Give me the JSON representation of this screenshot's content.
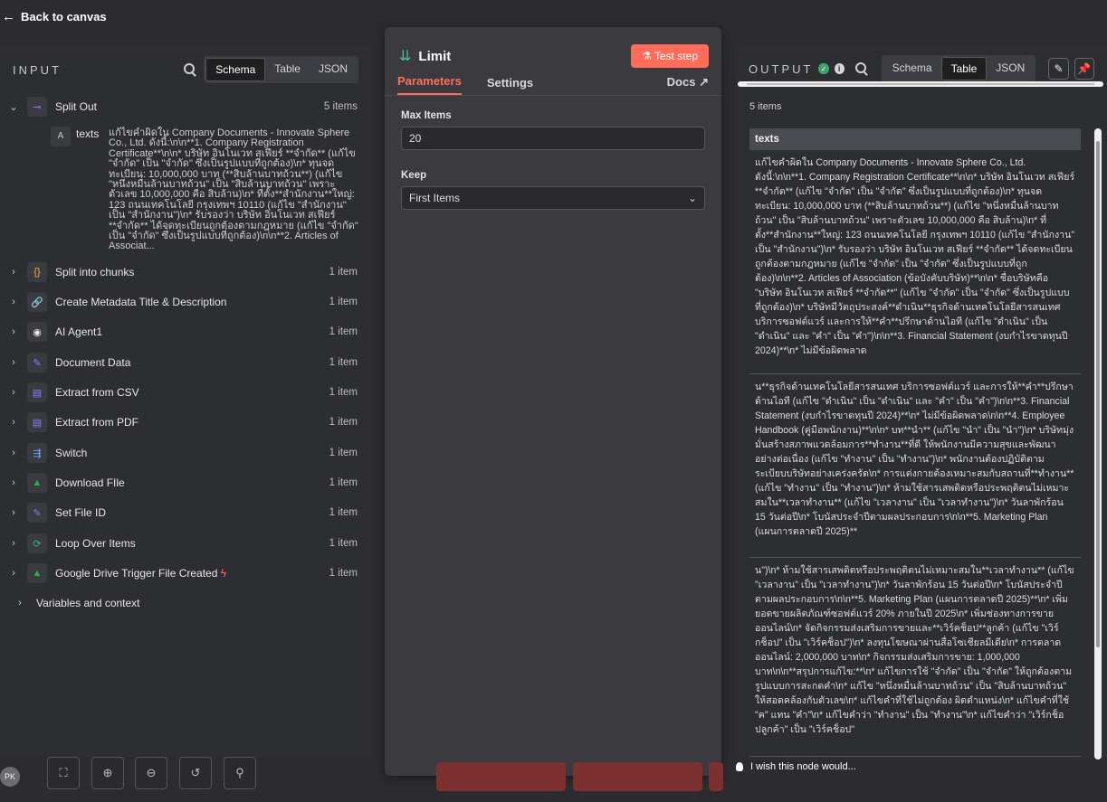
{
  "nav": {
    "back_label": "Back to canvas"
  },
  "input": {
    "title": "INPUT",
    "views": [
      "Schema",
      "Table",
      "JSON"
    ],
    "active_view": "Schema",
    "tree": [
      {
        "label": "Split Out",
        "count": "5 items",
        "icon": "split-out-icon",
        "expanded": true
      },
      {
        "label": "Split into chunks",
        "count": "1 item",
        "icon": "code-braces-icon"
      },
      {
        "label": "Create Metadata Title & Description",
        "count": "1 item",
        "icon": "link-icon"
      },
      {
        "label": "AI Agent1",
        "count": "1 item",
        "icon": "robot-icon"
      },
      {
        "label": "Document Data",
        "count": "1 item",
        "icon": "pencil-icon"
      },
      {
        "label": "Extract from CSV",
        "count": "1 item",
        "icon": "extract-icon"
      },
      {
        "label": "Extract from PDF",
        "count": "1 item",
        "icon": "extract-icon"
      },
      {
        "label": "Switch",
        "count": "1 item",
        "icon": "switch-icon"
      },
      {
        "label": "Download FIle",
        "count": "1 item",
        "icon": "google-drive-icon"
      },
      {
        "label": "Set File ID",
        "count": "1 item",
        "icon": "pencil-icon"
      },
      {
        "label": "Loop Over Items",
        "count": "1 item",
        "icon": "loop-icon"
      },
      {
        "label": "Google Drive Trigger File Created",
        "count": "1 item",
        "icon": "google-drive-icon"
      }
    ],
    "variables_label": "Variables and context",
    "texts_key": "texts",
    "texts_type_icon": "A",
    "texts_value": "แก้ไขคำผิดใน Company Documents - Innovate Sphere Co., Ltd. ดังนี้:\\n\\n**1. Company Registration Certificate**\\n\\n* บริษัท อินโนเวท สเฟียร์ **จำกัด** (แก้ไข \"จำกัด\" เป็น \"จำกัด\" ซึ่งเป็นรูปแบบที่ถูกต้อง)\\n* ทุนจดทะเบียน: 10,000,000 บาท (**สิบล้านบาทถ้วน**) (แก้ไข \"หนึ่งหมื่นล้านบาทถ้วน\" เป็น \"สิบล้านบาทถ้วน\" เพราะตัวเลข 10,000,000 คือ สิบล้าน)\\n* ที่ตั้ง**สำนักงาน**ใหญ่: 123 ถนนเทคโนโลยี กรุงเทพฯ 10110 (แก้ไข \"สำนักงาน\" เป็น \"สำนักงาน\")\\n* รับรองว่า บริษัท อินโนเวท สเฟียร์ **จำกัด** ได้จดทะเบียนถูกต้องตามกฎหมาย (แก้ไข \"จำกัด\" เป็น \"จำกัด\" ซึ่งเป็นรูปแบบที่ถูกต้อง)\\n\\n**2. Articles of Associat..."
  },
  "limit": {
    "title": "Limit",
    "test_label": "Test step",
    "tabs": [
      "Parameters",
      "Settings"
    ],
    "docs_label": "Docs",
    "max_items_label": "Max Items",
    "max_items_value": "20",
    "keep_label": "Keep",
    "keep_value": "First Items"
  },
  "output": {
    "title": "OUTPUT",
    "views": [
      "Schema",
      "Table",
      "JSON"
    ],
    "active_view": "Table",
    "items_count": "5 items",
    "column": "texts",
    "rows": [
      "แก้ไขคำผิดใน Company Documents - Innovate Sphere Co., Ltd. ดังนี้:\\n\\n**1. Company Registration Certificate**\\n\\n* บริษัท อินโนเวท สเฟียร์ **จำกัด** (แก้ไข \"จำกัด\" เป็น \"จำกัด\" ซึ่งเป็นรูปแบบที่ถูกต้อง)\\n* ทุนจดทะเบียน: 10,000,000 บาท (**สิบล้านบาทถ้วน**) (แก้ไข \"หนึ่งหมื่นล้านบาทถ้วน\" เป็น \"สิบล้านบาทถ้วน\" เพราะตัวเลข 10,000,000 คือ สิบล้าน)\\n* ที่ตั้ง**สำนักงาน**ใหญ่: 123 ถนนเทคโนโลยี กรุงเทพฯ 10110 (แก้ไข \"สำนักงาน\" เป็น \"สำนักงาน\")\\n* รับรองว่า บริษัท อินโนเวท สเฟียร์ **จำกัด** ได้จดทะเบียนถูกต้องตามกฎหมาย (แก้ไข \"จำกัด\" เป็น \"จำกัด\" ซึ่งเป็นรูปแบบที่ถูกต้อง)\\n\\n**2. Articles of Association (ข้อบังคับบริษัท)**\\n\\n* ชื่อบริษัทคือ \"บริษัท อินโนเวท สเฟียร์ **จำกัด**\" (แก้ไข \"จำกัด\" เป็น \"จำกัด\" ซึ่งเป็นรูปแบบที่ถูกต้อง)\\n* บริษัทมีวัตถุประสงค์**ดำเนิน**ธุรกิจด้านเทคโนโลยีสารสนเทศ บริการซอฟต์แวร์ และการให้**คำ**ปรึกษาด้านไอที (แก้ไข \"ดำเนิน\" เป็น \"ดำเนิน\" และ \"คำ\" เป็น \"คำ\")\\n\\n**3. Financial Statement (งบกำไรขาดทุนปี 2024)**\\n* ไม่มีข้อผิดพลาด",
      "น**ธุรกิจด้านเทคโนโลยีสารสนเทศ บริการซอฟต์แวร์ และการให้**คำ**ปรึกษาด้านไอที (แก้ไข \"ดำเนิน\" เป็น \"ดำเนิน\" และ \"คำ\" เป็น \"คำ\")\\n\\n**3. Financial Statement (งบกำไรขาดทุนปี 2024)**\\n* ไม่มีข้อผิดพลาด\\n\\n**4. Employee Handbook (คู่มือพนักงาน)**\\n\\n* บท**นำ** (แก้ไข \"นำ\" เป็น \"นำ\")\\n* บริษัทมุ่งมั่นสร้างสภาพแวดล้อมการ**ทำงาน**ที่ดี ให้พนักงานมีความสุขและพัฒนาอย่างต่อเนื่อง (แก้ไข \"ทำงาน\" เป็น \"ทำงาน\")\\n* พนักงานต้องปฏิบัติตามระเบียบบริษัทอย่างเคร่งครัด\\n* การแต่งกายต้องเหมาะสมกับสถานที่**ทำงาน** (แก้ไข \"ทำงาน\" เป็น \"ทำงาน\")\\n* ห้ามใช้สารเสพติดหรือประพฤติตนไม่เหมาะสมใน**เวลาทำงาน** (แก้ไข \"เวลางาน\" เป็น \"เวลาทำงาน\")\\n* วันลาพักร้อน 15 วันต่อปี\\n* โบนัสประจำปีตามผลประกอบการ\\n\\n**5. Marketing Plan (แผนการตลาดปี 2025)**",
      "น\")\\n* ห้ามใช้สารเสพติดหรือประพฤติตนไม่เหมาะสมใน**เวลาทำงาน** (แก้ไข \"เวลางาน\" เป็น \"เวลาทำงาน\")\\n* วันลาพักร้อน 15 วันต่อปี\\n* โบนัสประจำปีตามผลประกอบการ\\n\\n**5. Marketing Plan (แผนการตลาดปี 2025)**\\n* เพิ่มยอดขายผลิตภัณฑ์ซอฟต์แวร์ 20% ภายในปี 2025\\n* เพิ่มช่องทางการขายออนไลน์\\n* จัดกิจกรรมส่งเสริมการขายและ**เวิร์คช็อป**ลูกค้า (แก้ไข \"เวิร์กช็อป\" เป็น \"เวิร์คช็อป\")\\n* ลงทุนโฆษณาผ่านสื่อโซเชียลมีเดีย\\n* การตลาดออนไลน์: 2,000,000 บาท\\n* กิจกรรมส่งเสริมการขาย: 1,000,000 บาท\\n\\n**สรุปการแก้ไข:**\\n* แก้ไขการใช้ \"จำกัด\" เป็น \"จำกัด\" ให้ถูกต้องตามรูปแบบการสะกดคำ\\n* แก้ไข \"หนึ่งหมื่นล้านบาทถ้วน\" เป็น \"สิบล้านบาทถ้วน\" ให้สอดคล้องกับตัวเลข\\n* แก้ไขคำที่ใช้ไม่ถูกต้อง ผิดตำแหน่ง\\n* แก้ไขคำที่ใช้ \"ค\" แทน \"คำ\"\\n* แก้ไขคำว่า \"ทำงาน\" เป็น \"ทำงาน\"\\n* แก้ไขคำว่า \"เวิร์กช็อปลูกค้า\" เป็น \"เวิร์คช็อป\""
    ],
    "wish_label": "I wish this node would..."
  },
  "footer": {
    "avatar_initials": "PK"
  },
  "colors": {
    "accent": "#ff6d5a",
    "success": "#3fa36a",
    "panel": "#2d2e32",
    "node_panel": "#3a3a3f"
  }
}
